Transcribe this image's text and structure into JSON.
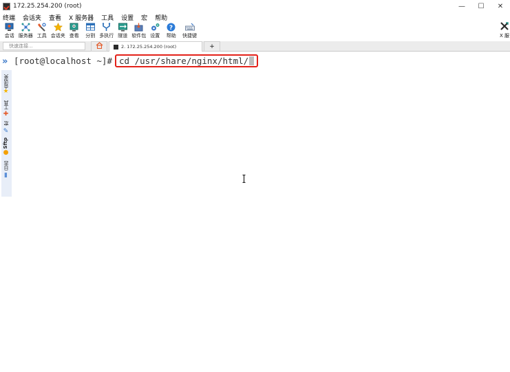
{
  "window": {
    "title": "172.25.254.200 (root)",
    "minimize": "—",
    "maximize": "☐",
    "close": "✕"
  },
  "menubar": [
    "终端",
    "会话夹",
    "查看",
    "X 服务器",
    "工具",
    "设置",
    "宏",
    "帮助"
  ],
  "toolbar": [
    {
      "label": "会话",
      "icon": "session-icon"
    },
    {
      "label": "服务器",
      "icon": "server-icon"
    },
    {
      "label": "工具",
      "icon": "tools-icon"
    },
    {
      "label": "会话夹",
      "icon": "star-icon"
    },
    {
      "label": "查看",
      "icon": "view-icon"
    },
    {
      "label": "分割",
      "icon": "split-icon"
    },
    {
      "label": "多执行",
      "icon": "multi-exec-icon"
    },
    {
      "label": "隧道",
      "icon": "tunnel-icon"
    },
    {
      "label": "软件包",
      "icon": "package-icon"
    },
    {
      "label": "设置",
      "icon": "gear-icon"
    },
    {
      "label": "帮助",
      "icon": "help-icon"
    },
    {
      "label": "快捷键",
      "icon": "keyboard-icon"
    }
  ],
  "xserver": {
    "label": "X 服"
  },
  "tabs": {
    "quick_connect_placeholder": "快速连接...",
    "session_tab_label": "2. 172.25.254.200 (root)",
    "add_tab": "+"
  },
  "sidebar": {
    "collapse": "»",
    "sessions": "会话夹",
    "tools": "工具",
    "macros": "宏",
    "sftp": "Sftp",
    "log": "日志"
  },
  "terminal": {
    "prompt": "[root@localhost ~]#",
    "command": "cd /usr/share/nginx/html/"
  },
  "colors": {
    "highlight_box": "#e32119",
    "accent": "#3a78c9"
  }
}
